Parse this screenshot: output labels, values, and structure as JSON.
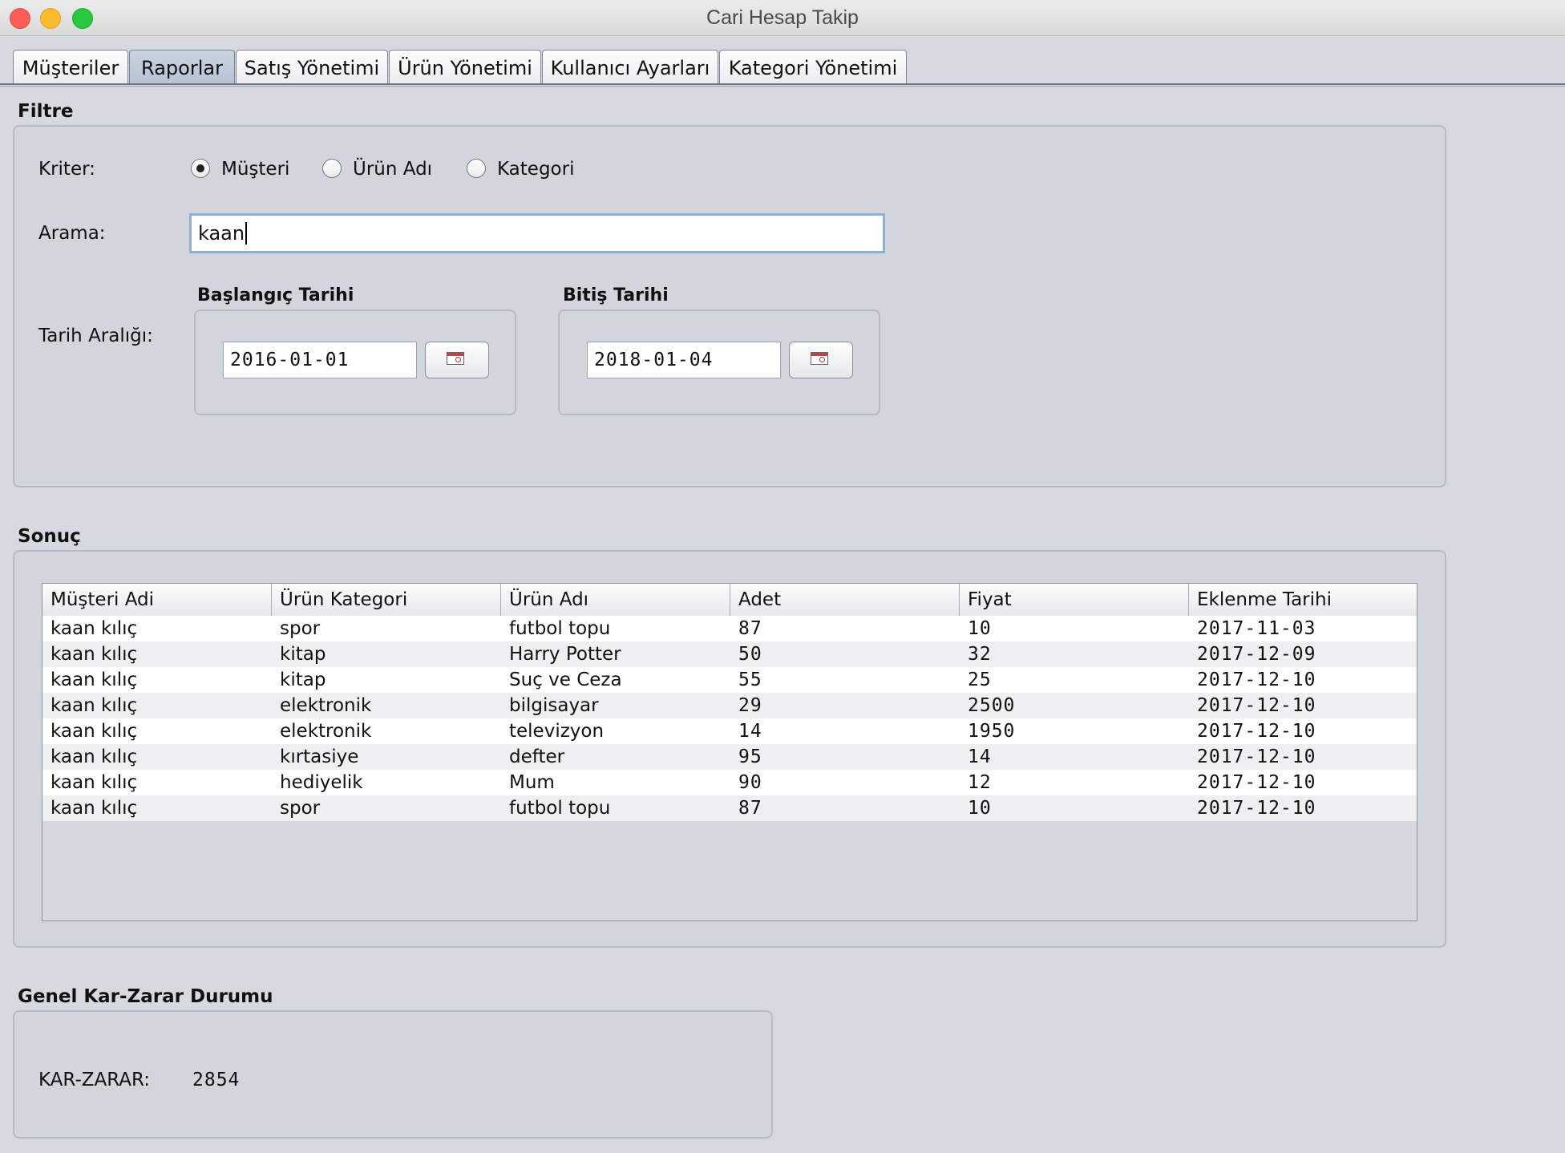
{
  "window": {
    "title": "Cari Hesap Takip"
  },
  "tabs": [
    {
      "label": "Müşteriler"
    },
    {
      "label": "Raporlar",
      "active": true
    },
    {
      "label": "Satış Yönetimi"
    },
    {
      "label": "Ürün Yönetimi"
    },
    {
      "label": "Kullanıcı Ayarları"
    },
    {
      "label": "Kategori Yönetimi"
    }
  ],
  "filter": {
    "title": "Filtre",
    "criteria_label": "Kriter:",
    "options": [
      {
        "label": "Müşteri",
        "selected": true
      },
      {
        "label": "Ürün Adı",
        "selected": false
      },
      {
        "label": "Kategori",
        "selected": false
      }
    ],
    "search_label": "Arama:",
    "search_value": "kaan",
    "date_range_label": "Tarih Aralığı:",
    "start": {
      "title": "Başlangıç Tarihi",
      "value": "2016-01-01"
    },
    "end": {
      "title": "Bitiş Tarihi",
      "value": "2018-01-04"
    }
  },
  "result": {
    "title": "Sonuç",
    "columns": [
      "Müşteri Adi",
      "Ürün Kategori",
      "Ürün Adı",
      "Adet",
      "Fiyat",
      "Eklenme Tarihi"
    ],
    "rows": [
      [
        "kaan kılıç",
        "spor",
        "futbol topu",
        "87",
        "10",
        "2017-11-03"
      ],
      [
        "kaan kılıç",
        "kitap",
        "Harry Potter",
        "50",
        "32",
        "2017-12-09"
      ],
      [
        "kaan kılıç",
        "kitap",
        "Suç ve Ceza",
        "55",
        "25",
        "2017-12-10"
      ],
      [
        "kaan kılıç",
        "elektronik",
        "bilgisayar",
        "29",
        "2500",
        "2017-12-10"
      ],
      [
        "kaan kılıç",
        "elektronik",
        "televizyon",
        "14",
        "1950",
        "2017-12-10"
      ],
      [
        "kaan kılıç",
        "kırtasiye",
        "defter",
        "95",
        "14",
        "2017-12-10"
      ],
      [
        "kaan kılıç",
        "hediyelik",
        "Mum",
        "90",
        "12",
        "2017-12-10"
      ],
      [
        "kaan kılıç",
        "spor",
        "futbol topu",
        "87",
        "10",
        "2017-12-10"
      ]
    ]
  },
  "summary": {
    "title": "Genel Kar-Zarar Durumu",
    "label": "KAR-ZARAR:",
    "value": "2854"
  }
}
